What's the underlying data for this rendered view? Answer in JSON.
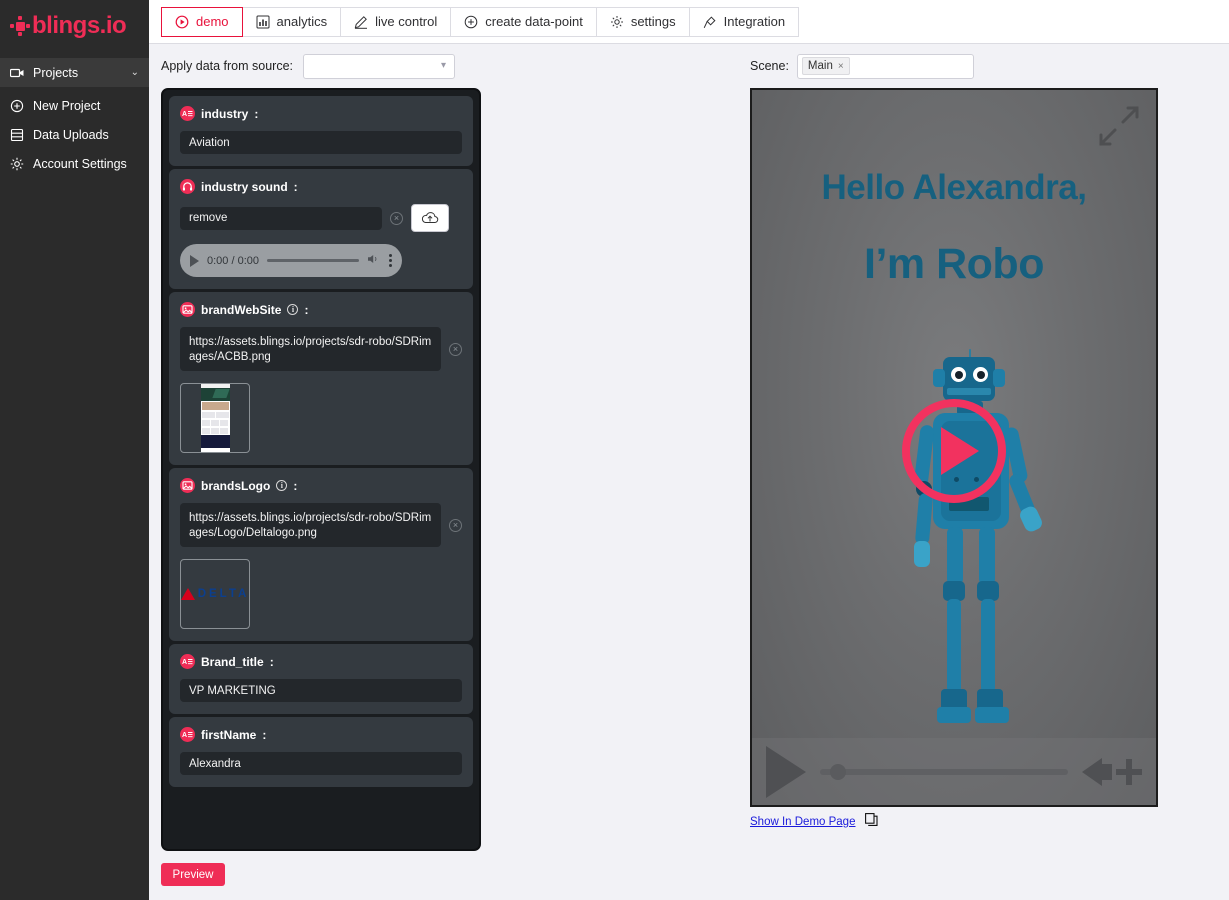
{
  "brand": {
    "logo_text": "blings.io",
    "accent": "#ef2d56"
  },
  "sidebar": {
    "items": [
      {
        "label": "Projects",
        "icon": "video-camera-icon",
        "chevron": "⌄",
        "active": true
      },
      {
        "label": "New Project",
        "icon": "plus-circle-icon"
      },
      {
        "label": "Data Uploads",
        "icon": "list-icon"
      },
      {
        "label": "Account Settings",
        "icon": "gear-icon"
      }
    ]
  },
  "tabs": [
    {
      "label": "demo",
      "icon": "play-circle-icon",
      "active": true
    },
    {
      "label": "analytics",
      "icon": "bar-chart-icon",
      "active": false
    },
    {
      "label": "live control",
      "icon": "pencil-icon",
      "active": false
    },
    {
      "label": "create data-point",
      "icon": "plus-circle-icon",
      "active": false
    },
    {
      "label": "settings",
      "icon": "gear-icon",
      "active": false
    },
    {
      "label": "Integration",
      "icon": "plug-icon",
      "active": false
    }
  ],
  "source": {
    "label": "Apply data from source:",
    "value": "",
    "placeholder": ""
  },
  "scene": {
    "label": "Scene:",
    "chip": "Main",
    "chip_close": "×"
  },
  "form": {
    "fields": [
      {
        "name": "industry",
        "icon": "text-field-icon",
        "has_info": false,
        "value": "Aviation",
        "type": "text"
      },
      {
        "name": "industry sound",
        "icon": "headphones-icon",
        "has_info": false,
        "value": "remove",
        "type": "audio",
        "audio": {
          "time": "0:00 / 0:00"
        }
      },
      {
        "name": "brandWebSite",
        "icon": "image-icon",
        "has_info": true,
        "value": "https://assets.blings.io/projects/sdr-robo/SDRimages/ACBB.png",
        "type": "image",
        "thumb": "website-screenshot-thumbnail"
      },
      {
        "name": "brandsLogo",
        "icon": "image-icon",
        "has_info": true,
        "value": "https://assets.blings.io/projects/sdr-robo/SDRimages/Logo/Deltalogo.png",
        "type": "image",
        "thumb": "delta-logo-thumbnail",
        "thumb_text": "DELTA"
      },
      {
        "name": "Brand_title",
        "icon": "text-field-icon",
        "has_info": false,
        "value": "VP MARKETING",
        "type": "text"
      },
      {
        "name": "firstName",
        "icon": "text-field-icon",
        "has_info": false,
        "value": "Alexandra",
        "type": "text"
      }
    ],
    "colon": ":",
    "info_glyph": "i",
    "clear_glyph": "×",
    "preview_button": "Preview"
  },
  "video": {
    "line1": "Hello Alexandra,",
    "line2": "I’m Robo",
    "text_color": "#16607f",
    "play_color": "#f2325f",
    "demo_link": "Show In Demo Page"
  }
}
